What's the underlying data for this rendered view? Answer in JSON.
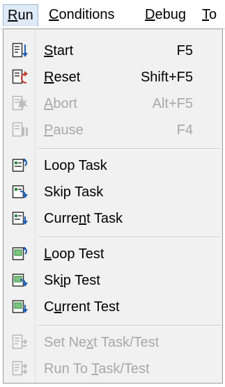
{
  "menubar": {
    "items": [
      {
        "pre": "",
        "acc": "R",
        "post": "un"
      },
      {
        "pre": "",
        "acc": "C",
        "post": "onditions"
      },
      {
        "pre": "",
        "acc": "D",
        "post": "ebug"
      },
      {
        "pre": "",
        "acc": "T",
        "post": "o"
      }
    ]
  },
  "menu": {
    "items": [
      {
        "pre": "",
        "acc": "S",
        "post": "tart",
        "shortcut": "F5",
        "icon": "start-icon",
        "enabled": true
      },
      {
        "pre": "",
        "acc": "R",
        "post": "eset",
        "shortcut": "Shift+F5",
        "icon": "reset-icon",
        "enabled": true
      },
      {
        "pre": "",
        "acc": "A",
        "post": "bort",
        "shortcut": "Alt+F5",
        "icon": "abort-icon",
        "enabled": false
      },
      {
        "pre": "",
        "acc": "P",
        "post": "ause",
        "shortcut": "F4",
        "icon": "pause-icon",
        "enabled": false
      },
      {
        "pre": "Loop Task",
        "acc": "",
        "post": "",
        "shortcut": "",
        "icon": "loop-task-icon",
        "enabled": true
      },
      {
        "pre": "Skip Task",
        "acc": "",
        "post": "",
        "shortcut": "",
        "icon": "skip-task-icon",
        "enabled": true
      },
      {
        "pre": "Curre",
        "acc": "n",
        "post": "t Task",
        "shortcut": "",
        "icon": "current-task-icon",
        "enabled": true
      },
      {
        "pre": "",
        "acc": "L",
        "post": "oop Test",
        "shortcut": "",
        "icon": "loop-test-icon",
        "enabled": true
      },
      {
        "pre": "Sk",
        "acc": "i",
        "post": "p Test",
        "shortcut": "",
        "icon": "skip-test-icon",
        "enabled": true
      },
      {
        "pre": "C",
        "acc": "u",
        "post": "rrent Test",
        "shortcut": "",
        "icon": "current-test-icon",
        "enabled": true
      },
      {
        "pre": "Set Ne",
        "acc": "x",
        "post": "t Task/Test",
        "shortcut": "",
        "icon": "set-next-icon",
        "enabled": false
      },
      {
        "pre": "Run To ",
        "acc": "T",
        "post": "ask/Test",
        "shortcut": "",
        "icon": "run-to-icon",
        "enabled": false
      }
    ]
  }
}
